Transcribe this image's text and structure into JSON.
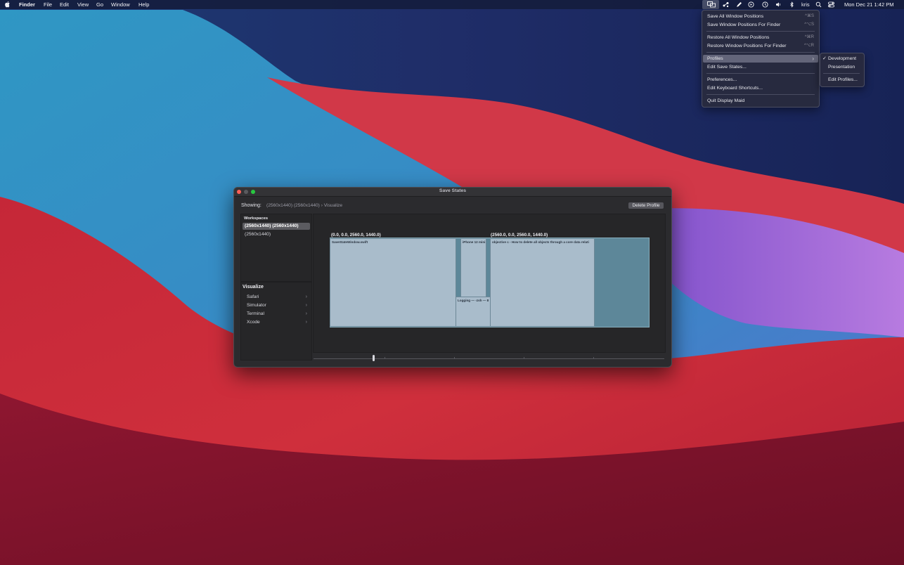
{
  "menubar": {
    "app_name": "Finder",
    "menus": [
      "File",
      "Edit",
      "View",
      "Go",
      "Window",
      "Help"
    ],
    "user": "kris",
    "clock": "Mon Dec 21  1:42 PM",
    "status_icons": [
      "display-maid-icon",
      "share-icon",
      "pen-icon",
      "play-circle-icon",
      "time-machine-icon",
      "volume-icon",
      "bluetooth-icon",
      "search-icon",
      "control-center-icon"
    ]
  },
  "menu": {
    "items": [
      {
        "label": "Save All Window Positions",
        "shortcut": "^⌘S"
      },
      {
        "label": "Save Window Positions For Finder",
        "shortcut": "^⌥S"
      },
      {
        "label": "Restore All Window Positions",
        "shortcut": "^⌘R"
      },
      {
        "label": "Restore Window Positions For Finder",
        "shortcut": "^⌥R"
      },
      {
        "label": "Profiles"
      },
      {
        "label": "Edit Save States..."
      },
      {
        "label": "Preferences..."
      },
      {
        "label": "Edit Keyboard Shortcuts..."
      },
      {
        "label": "Quit Display Maid"
      }
    ]
  },
  "submenu": {
    "items": [
      {
        "label": "Development",
        "checked": true
      },
      {
        "label": "Presentation",
        "checked": false
      },
      {
        "label": "Edit Profiles...",
        "checked": false
      }
    ]
  },
  "window": {
    "title": "Save States",
    "showing_label": "Showing:",
    "showing_path": "(2560x1440) (2560x1440)  › Visualize",
    "delete_button": "Delete Profile",
    "workspaces_header": "Workspaces",
    "workspaces": [
      "(2560x1440) (2560x1440)",
      "(2560x1440)"
    ],
    "visualize_header": "Visualize",
    "visualize_items": [
      "Safari",
      "Simulator",
      "Terminal",
      "Xcode"
    ],
    "displays": [
      {
        "label": "(0.0, 0.0, 2560.0, 1440.0)"
      },
      {
        "label": "(2560.0, 0.0, 2560.0, 1440.0)"
      }
    ],
    "windows": [
      {
        "title": "SaveStateWindow.swift"
      },
      {
        "title": "iPhone 12 mini"
      },
      {
        "title": "Logging — -zsh — 8"
      },
      {
        "title": "objective c - How to delete all objects through a core data relati"
      }
    ]
  },
  "colors": {
    "menubar_bg": "#141c3a",
    "display_fill": "#5d8799",
    "window_fill": "#a9bccb",
    "close_button": "#fe5f57",
    "zoom_button": "#28c840"
  }
}
